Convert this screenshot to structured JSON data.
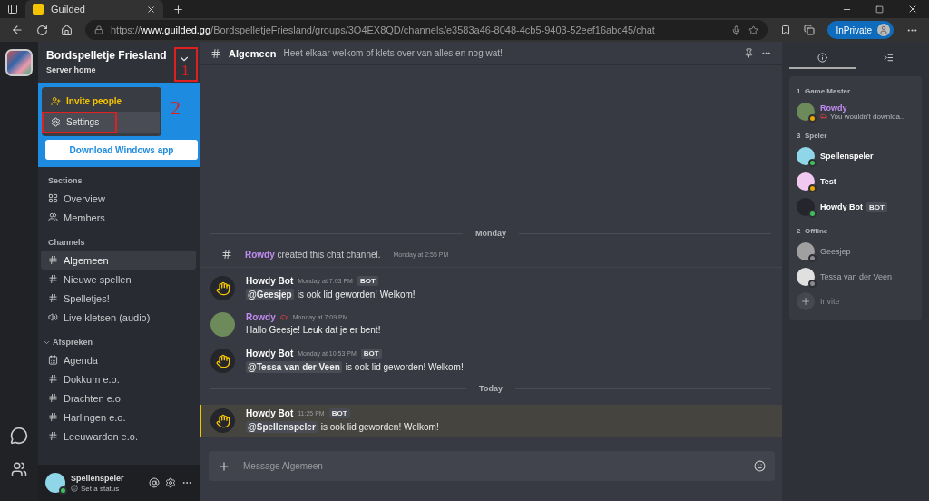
{
  "browser": {
    "tab_title": "Guilded",
    "url_scheme": "https://",
    "url_domain": "www.guilded.gg",
    "url_path": "/BordspelletjeFriesland/groups/3O4EX8QD/channels/e3583a46-8048-4cb5-9403-52eef16abc45/chat",
    "profile_label": "InPrivate"
  },
  "server": {
    "name": "Bordspelletje Friesland",
    "subtitle": "Server home"
  },
  "annotations": [
    {
      "label": "1"
    },
    {
      "label": "2"
    }
  ],
  "menu": [
    {
      "kind": "invite",
      "label": "Invite people",
      "selected": false
    },
    {
      "kind": "settings",
      "label": "Settings",
      "selected": true
    }
  ],
  "download_button": "Download Windows app",
  "sections": {
    "title": "Sections",
    "items": [
      {
        "kind": "overview",
        "label": "Overview"
      },
      {
        "kind": "members",
        "label": "Members"
      }
    ]
  },
  "channels": {
    "title": "Channels",
    "items": [
      {
        "kind": "text",
        "label": "Algemeen",
        "selected": true
      },
      {
        "kind": "text",
        "label": "Nieuwe spellen",
        "selected": false
      },
      {
        "kind": "text",
        "label": "Spelletjes!",
        "selected": false
      },
      {
        "kind": "voice",
        "label": "Live kletsen (audio)",
        "selected": false
      }
    ]
  },
  "group": {
    "title": "Afspreken",
    "expanded": true,
    "items": [
      {
        "kind": "calendar",
        "label": "Agenda",
        "selected": false
      },
      {
        "kind": "text",
        "label": "Dokkum e.o.",
        "selected": false
      },
      {
        "kind": "text",
        "label": "Drachten e.o.",
        "selected": false
      },
      {
        "kind": "text",
        "label": "Harlingen e.o.",
        "selected": false
      },
      {
        "kind": "text",
        "label": "Leeuwarden e.o.",
        "selected": false
      }
    ]
  },
  "user": {
    "name": "Spellenspeler",
    "status": "Set a status",
    "color": "#3fbf5a"
  },
  "channel_header": {
    "name": "Algemeen",
    "topic": "Heet elkaar welkom of klets over van alles en nog wat!"
  },
  "feed": [
    {
      "kind": "divider",
      "label": "Monday"
    },
    {
      "kind": "system",
      "author": "Rowdy",
      "text": "created this chat channel.",
      "time": "Monday at 2:55 PM"
    },
    {
      "kind": "bot",
      "author": "Howdy Bot",
      "time": "Monday at 7:03 PM",
      "badge": "BOT",
      "mention": "@Geesjep",
      "text": "is ook lid geworden! Welkom!",
      "highlighted": false
    },
    {
      "kind": "user",
      "author": "Rowdy",
      "time": "Monday at 7:09 PM",
      "text": "Hallo Geesje! Leuk dat je er bent!",
      "highlighted": false
    },
    {
      "kind": "bot",
      "author": "Howdy Bot",
      "time": "Monday at 10:53 PM",
      "badge": "BOT",
      "mention": "@Tessa van der Veen",
      "text": "is ook lid geworden! Welkom!",
      "highlighted": false
    },
    {
      "kind": "divider",
      "label": "Today"
    },
    {
      "kind": "bot",
      "author": "Howdy Bot",
      "time": "11:25 PM",
      "badge": "BOT",
      "mention": "@Spellenspeler",
      "text": "is ook lid geworden! Welkom!",
      "highlighted": true
    }
  ],
  "composer": {
    "placeholder": "Message Algemeen"
  },
  "panel_tabs": [
    {
      "kind": "info",
      "selected": true
    },
    {
      "kind": "list",
      "selected": false
    }
  ],
  "member_groups": [
    {
      "count": "1",
      "title": "Game Master",
      "members": [
        {
          "name": "Rowdy",
          "kind": "photo",
          "role_colored": true,
          "status_text": "You wouldn't downloa...",
          "color": "#e8a800"
        }
      ]
    },
    {
      "count": "3",
      "title": "Speler",
      "members": [
        {
          "name": "Spellenspeler",
          "kind": "cyan",
          "role_colored": false,
          "color": "#3fbf5a"
        },
        {
          "name": "Test",
          "kind": "pink",
          "role_colored": false,
          "color": "#e8a800"
        },
        {
          "name": "Howdy Bot",
          "kind": "bot",
          "role_colored": false,
          "badge": "BOT",
          "color": "#3fbf5a"
        }
      ]
    },
    {
      "count": "2",
      "title": "Offline",
      "members": [
        {
          "name": "Geesjep",
          "kind": "grey",
          "role_colored": false,
          "offline": true,
          "color": "#8a8b8f"
        },
        {
          "name": "Tessa van der Veen",
          "kind": "light",
          "role_colored": false,
          "offline": true,
          "color": "#8a8b8f"
        }
      ]
    }
  ],
  "invite_label": "Invite"
}
